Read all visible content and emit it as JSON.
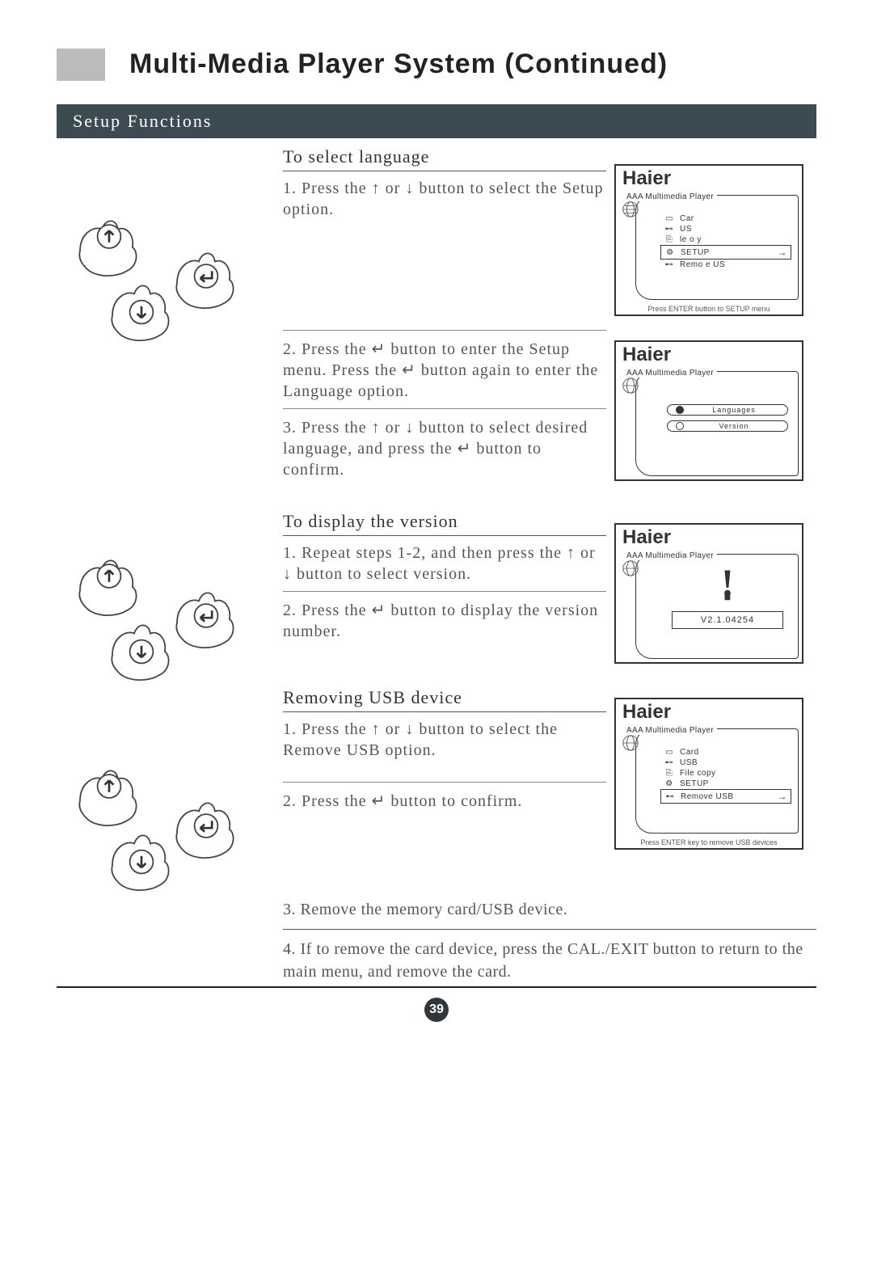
{
  "page_title": "Multi-Media Player System (Continued)",
  "setup_header": "Setup Functions",
  "sections": {
    "lang": {
      "title": "To select language",
      "step1": "1. Press the ↑ or ↓ button to select the Setup option.",
      "step2": "2. Press the ↵ button to enter the Setup menu. Press the ↵ button again to enter the Language option.",
      "step3": "3. Press the ↑ or ↓ button to select desired language, and press the ↵ button to confirm."
    },
    "ver": {
      "title": "To display the version",
      "step1": "1. Repeat steps 1-2, and then press the ↑ or ↓ button to select version.",
      "step2": "2. Press the ↵ button to display the version number."
    },
    "rem": {
      "title": "Removing USB device",
      "step1": "1. Press the ↑ or ↓ button to select the Remove USB option.",
      "step2": "2. Press the ↵ button to confirm.",
      "step3": "3. Remove the memory card/USB device.",
      "step4": "4. If to remove the card device, press the CAL./EXIT button to return to the main menu, and remove the card."
    }
  },
  "screens": {
    "brand": "Haier",
    "player_title": "AAA Multimedia Player",
    "menu1": {
      "items": [
        "Car",
        "US",
        "le o y",
        "SETUP",
        "Remo e US"
      ],
      "caption": "Press ENTER button to SETUP menu"
    },
    "menu2": {
      "languages": "Languages",
      "version": "Version"
    },
    "menu3": {
      "version_str": "V2.1.04254"
    },
    "menu4": {
      "items": [
        "Card",
        "USB",
        "File copy",
        "SETUP",
        "Remove USB"
      ],
      "caption": "Press ENTER key to remove USB devices"
    }
  },
  "page_number": "39"
}
